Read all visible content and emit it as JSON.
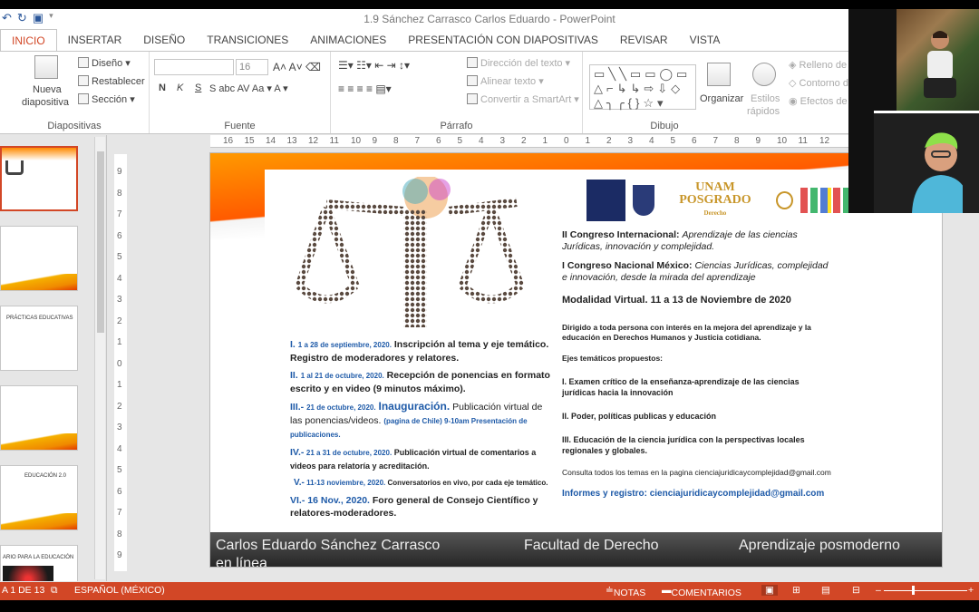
{
  "window": {
    "title": "1.9 Sánchez Carrasco Carlos Eduardo - PowerPoint"
  },
  "quick_access": {
    "undo_icon": "undo-icon",
    "redo_icon": "redo-icon",
    "present_icon": "present-icon"
  },
  "tabs": [
    "INICIO",
    "INSERTAR",
    "DISEÑO",
    "TRANSICIONES",
    "ANIMACIONES",
    "PRESENTACIÓN CON DIAPOSITIVAS",
    "REVISAR",
    "VISTA"
  ],
  "ribbon": {
    "diapositivas": {
      "nueva": "Nueva",
      "diapositiva": "diapositiva",
      "diseno": "Diseño",
      "restablecer": "Restablecer",
      "seccion": "Sección",
      "label": "Diapositivas"
    },
    "fuente": {
      "size": "16",
      "n": "N",
      "k": "K",
      "s": "S",
      "label": "Fuente"
    },
    "parrafo": {
      "direccion": "Dirección del texto",
      "alinear": "Alinear texto",
      "smartart": "Convertir a SmartArt",
      "label": "Párrafo"
    },
    "dibujo": {
      "organizar": "Organizar",
      "estilos1": "Estilos",
      "estilos2": "rápidos",
      "relleno": "Relleno de",
      "contorno": "Contorno d",
      "efectos": "Efectos de",
      "label": "Dibujo"
    }
  },
  "ruler_labels": [
    "16",
    "15",
    "14",
    "13",
    "12",
    "11",
    "10",
    "9",
    "8",
    "7",
    "6",
    "5",
    "4",
    "3",
    "2",
    "1",
    "0",
    "1",
    "2",
    "3",
    "4",
    "5",
    "6",
    "7",
    "8",
    "9",
    "10",
    "11",
    "12"
  ],
  "vruler_labels": [
    "9",
    "8",
    "7",
    "6",
    "5",
    "4",
    "3",
    "2",
    "1",
    "0",
    "1",
    "2",
    "3",
    "4",
    "5",
    "6",
    "7",
    "8",
    "9"
  ],
  "thumbnails": [
    {
      "text": "",
      "active": true
    },
    {
      "text": "",
      "active": false
    },
    {
      "text": "PRÁCTICAS EDUCATIVAS",
      "active": false
    },
    {
      "text": "",
      "active": false
    },
    {
      "text": "EDUCACIÓN 2.0",
      "active": false
    },
    {
      "text": "ARIO PARA LA EDUCACIÓN",
      "active": false
    }
  ],
  "slide": {
    "logo_posgrado": "UNAM POSGRADO",
    "logo_posgrado_sub": "Derecho",
    "left_items": [
      {
        "num": "I.",
        "date": "1 a 28 de septiembre, 2020.",
        "text": "Inscripción al tema y eje temático. Registro de moderadores y relatores."
      },
      {
        "num": "II.",
        "date": "1 al 21 de octubre, 2020.",
        "text": "Recepción de ponencias en formato escrito y en video (9 minutos máximo)."
      },
      {
        "num": "III.-",
        "date": "21 de octubre, 2020.",
        "highlight": "Inauguración.",
        "text": "Publicación virtual de las ponencias/videos.",
        "note": "(pagina de Chile) 9-10am Presentación de publicaciones."
      },
      {
        "num": "IV.-",
        "date": "21 a 31 de octubre, 2020.",
        "text": "Publicación virtual de comentarios a videos para relatoría y acreditación."
      },
      {
        "num": "V.-",
        "date": "11-13 noviembre, 2020.",
        "text": "Conversatorios en vivo, por cada eje temático."
      },
      {
        "num": "VI.-",
        "date": "16 Nov., 2020.",
        "text": "Foro general de Consejo Científico y relatores-moderadores."
      }
    ],
    "congreso1_bold": "II Congreso Internacional:",
    "congreso1_it": "Aprendizaje de las ciencias Jurídicas, innovación y complejidad.",
    "congreso2_bold": "I Congreso Nacional México:",
    "congreso2_it": "Ciencias Jurídicas, complejidad e innovación, desde la mirada del aprendizaje",
    "modalidad": "Modalidad Virtual. 11 a 13 de Noviembre de 2020",
    "dirigido": "Dirigido a toda persona con interés en la mejora del aprendizaje y la educación en Derechos Humanos y Justicia cotidiana.",
    "ejes_title": "Ejes temáticos propuestos:",
    "eje1": "I. Examen crítico de la enseñanza-aprendizaje de las ciencias jurídicas hacia la innovación",
    "eje2": "II. Poder, políticas publicas y educación",
    "eje3": "III. Educación de la ciencia jurídica con la perspectivas locales regionales y globales.",
    "consulta": "Consulta todos los temas en la pagina cienciajuridicaycomplejidad@gmail.com",
    "informes": "Informes y registro: cienciajuridicaycomplejidad@gmail.com",
    "footer_name": "Carlos Eduardo Sánchez Carrasco",
    "footer_line2": "en línea",
    "footer_faculty": "Facultad de Derecho",
    "footer_topic": "Aprendizaje posmoderno"
  },
  "status": {
    "slide": "A 1 DE 13",
    "language": "ESPAÑOL (MÉXICO)",
    "notas": "NOTAS",
    "comentarios": "COMENTARIOS"
  },
  "colors": {
    "accent": "#d24726",
    "slide_blue": "#1e5aa8"
  }
}
